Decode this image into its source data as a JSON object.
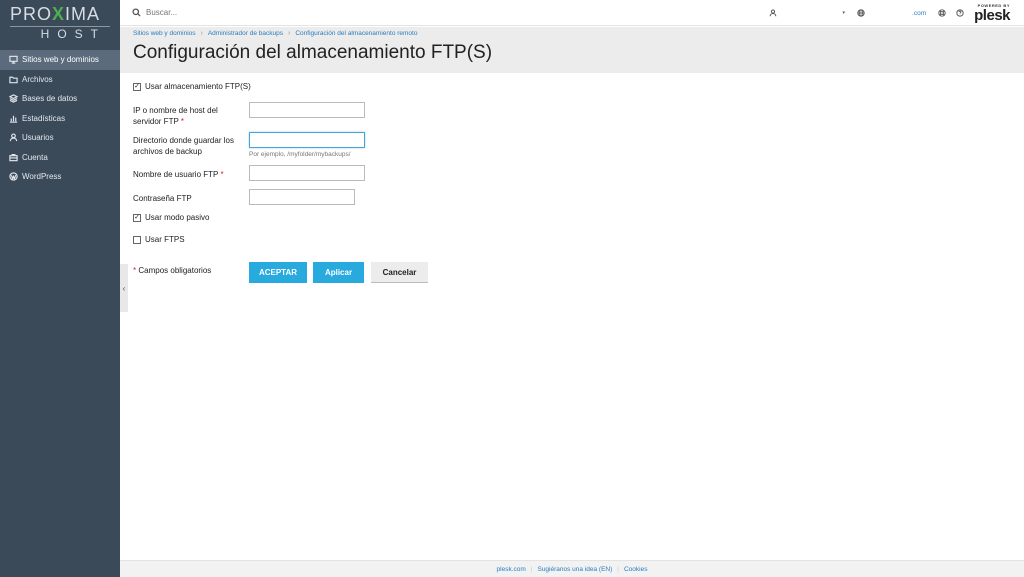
{
  "brand": {
    "logo_top_a": "PRO",
    "logo_top_x": "X",
    "logo_top_b": "IMA",
    "logo_bottom": "HOST"
  },
  "sidebar": {
    "items": [
      {
        "label": "Sitios web y dominios",
        "icon": "monitor-icon",
        "active": true
      },
      {
        "label": "Archivos",
        "icon": "folder-icon",
        "active": false
      },
      {
        "label": "Bases de datos",
        "icon": "database-icon",
        "active": false
      },
      {
        "label": "Estadísticas",
        "icon": "bar-chart-icon",
        "active": false
      },
      {
        "label": "Usuarios",
        "icon": "user-icon",
        "active": false
      },
      {
        "label": "Cuenta",
        "icon": "briefcase-icon",
        "active": false
      },
      {
        "label": "WordPress",
        "icon": "wordpress-icon",
        "active": false
      }
    ],
    "collapse_glyph": "‹"
  },
  "topbar": {
    "search_placeholder": "Buscar...",
    "domain": ".com",
    "dropdown_glyph": "▾",
    "powered_by": "POWERED BY",
    "plesk": "plesk"
  },
  "breadcrumb": [
    "Sitios web y dominios",
    "Administrador de backups",
    "Configuración del almacenamiento remoto"
  ],
  "page_title": "Configuración del almacenamiento FTP(S)",
  "form": {
    "use_ftp_label": "Usar almacenamiento FTP(S)",
    "use_ftp_checked": true,
    "host_label": "IP o nombre de host del servidor FTP",
    "host_value": "",
    "dir_label": "Directorio donde guardar los archivos de backup",
    "dir_value": "",
    "dir_hint": "Por ejemplo, /myfolder/mybackups/",
    "user_label": "Nombre de usuario FTP",
    "user_value": "",
    "password_label": "Contraseña FTP",
    "password_value": "",
    "passive_label": "Usar modo pasivo",
    "passive_checked": true,
    "ftps_label": "Usar FTPS",
    "ftps_checked": false,
    "required_star": "*",
    "required_note": "Campos obligatorios",
    "accept_button": "ACEPTAR",
    "apply_button": "Aplicar",
    "cancel_button": "Cancelar"
  },
  "footer": {
    "links": [
      "plesk.com",
      "Sugiéranos una idea (EN)",
      "Cookies"
    ]
  },
  "colors": {
    "sidebar": "#3b4a59",
    "accent": "#28aade",
    "link": "#2a7dbf",
    "required": "#d8232a"
  }
}
